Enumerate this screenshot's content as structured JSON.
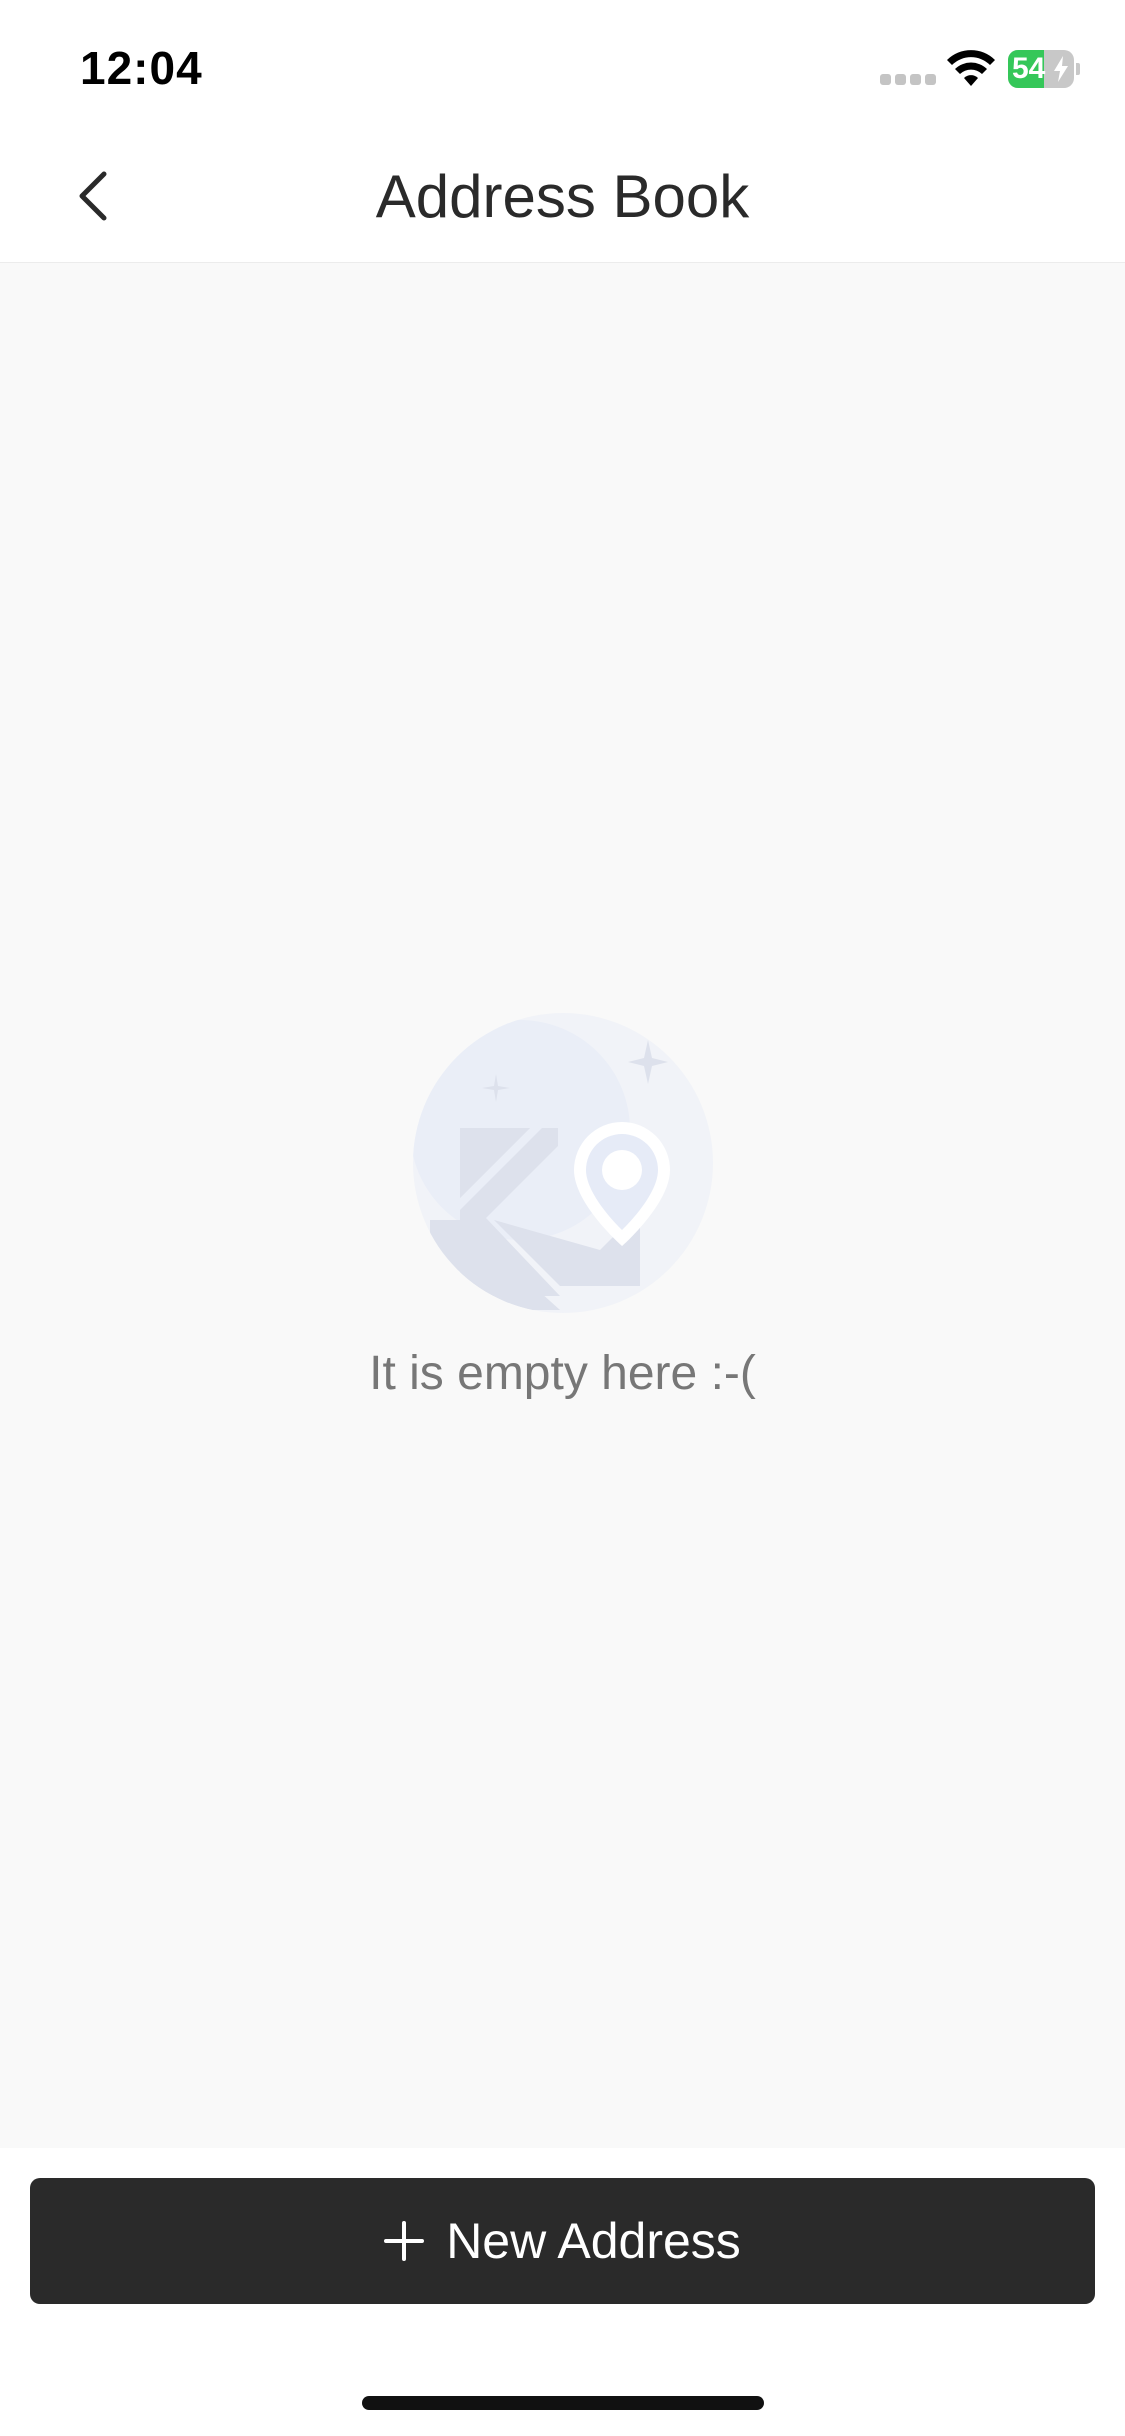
{
  "status_bar": {
    "time": "12:04",
    "battery_level": "54",
    "battery_fraction": 0.54
  },
  "nav": {
    "title": "Address Book",
    "back_icon": "chevron-left-icon"
  },
  "empty_state": {
    "illustration_icon": "map-location-pin-icon",
    "message": "It is empty here :-("
  },
  "actions": {
    "new_address_label": "New Address",
    "new_address_icon": "plus-icon"
  },
  "colors": {
    "button_bg": "#2a2a2a",
    "page_bg": "#f9f9f9",
    "battery_green": "#35c759",
    "illustration": "#dde1ec"
  }
}
